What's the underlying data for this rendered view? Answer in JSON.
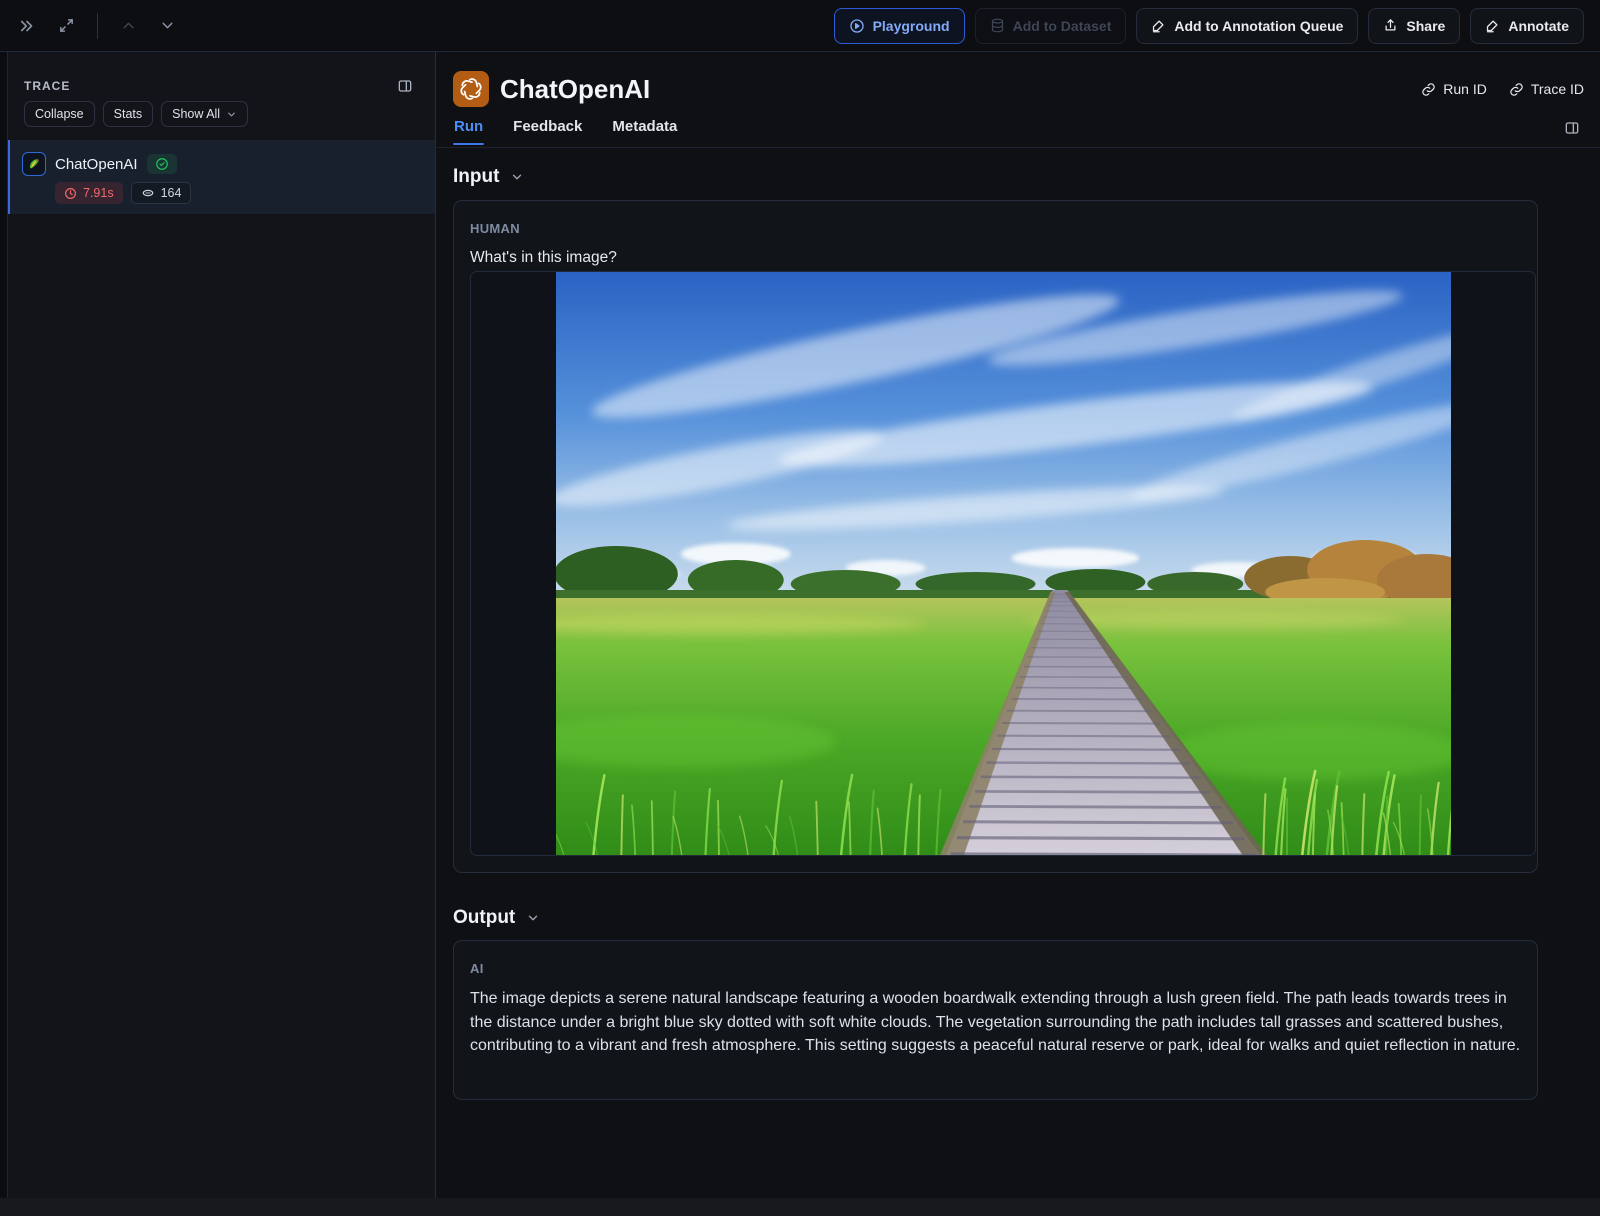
{
  "topbar": {
    "playground_label": "Playground",
    "add_to_dataset_label": "Add to Dataset",
    "add_to_annotation_queue_label": "Add to Annotation Queue",
    "share_label": "Share",
    "annotate_label": "Annotate"
  },
  "sidebar": {
    "title": "TRACE",
    "collapse_label": "Collapse",
    "stats_label": "Stats",
    "show_all_label": "Show All",
    "trace_item": {
      "name": "ChatOpenAI",
      "status": "success",
      "duration": "7.91s",
      "tokens": "164"
    }
  },
  "main": {
    "title": "ChatOpenAI",
    "run_id_label": "Run ID",
    "trace_id_label": "Trace ID",
    "tabs": [
      "Run",
      "Feedback",
      "Metadata"
    ],
    "active_tab": "Run",
    "input_section": {
      "heading": "Input",
      "role_label": "HUMAN",
      "message": "What's in this image?",
      "image_description": "wooden boardwalk path through tall green grass field under a bright blue sky with wispy white clouds"
    },
    "output_section": {
      "heading": "Output",
      "role_label": "AI",
      "message": "The image depicts a serene natural landscape featuring a wooden boardwalk extending through a lush green field. The path leads towards trees in the distance under a bright blue sky dotted with soft white clouds. The vegetation surrounding the path includes tall grasses and scattered bushes, contributing to a vibrant and fresh atmosphere. This setting suggests a peaceful natural reserve or park, ideal for walks and quiet reflection in nature."
    }
  },
  "colors": {
    "accent_blue": "#4d8df6",
    "error_red": "#ef6a6a",
    "success_green": "#22c55e",
    "openai_orange": "#b35c14"
  }
}
